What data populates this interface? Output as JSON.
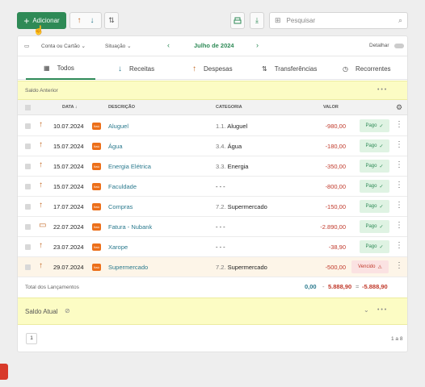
{
  "toolbar": {
    "add_label": "Adicionar",
    "search_placeholder": "Pesquisar"
  },
  "filters": {
    "account": "Conta ou Cartão",
    "status": "Situação",
    "month": "Julho de 2024",
    "detail": "Detalhar"
  },
  "tabs": [
    {
      "label": "Todos",
      "icon": "calendar-icon"
    },
    {
      "label": "Receitas",
      "icon": "arrow-down-icon"
    },
    {
      "label": "Despesas",
      "icon": "arrow-up-icon"
    },
    {
      "label": "Transferências",
      "icon": "transfer-icon"
    },
    {
      "label": "Recorrentes",
      "icon": "clock-icon"
    }
  ],
  "saldo_anterior": {
    "label": "Saldo Anterior",
    "more": "• • •"
  },
  "columns": {
    "data": "DATA ↓",
    "descricao": "DESCRIÇÃO",
    "categoria": "CATEGORIA",
    "valor": "VALOR"
  },
  "rows": [
    {
      "date": "10.07.2024",
      "desc": "Aluguel",
      "cat_num": "1.1.",
      "cat": "Aluguel",
      "value": "-980,00",
      "status": "Pago",
      "icon": "arrow-up-icon"
    },
    {
      "date": "15.07.2024",
      "desc": "Água",
      "cat_num": "3.4.",
      "cat": "Água",
      "value": "-180,00",
      "status": "Pago",
      "icon": "arrow-up-icon"
    },
    {
      "date": "15.07.2024",
      "desc": "Energia Elétrica",
      "cat_num": "3.3.",
      "cat": "Energia",
      "value": "-350,00",
      "status": "Pago",
      "icon": "arrow-up-icon"
    },
    {
      "date": "15.07.2024",
      "desc": "Faculdade",
      "cat_num": "",
      "cat": "- - -",
      "value": "-800,00",
      "status": "Pago",
      "icon": "arrow-up-icon"
    },
    {
      "date": "17.07.2024",
      "desc": "Compras",
      "cat_num": "7.2.",
      "cat": "Supermercado",
      "value": "-150,00",
      "status": "Pago",
      "icon": "arrow-up-icon"
    },
    {
      "date": "22.07.2024",
      "desc": "Fatura - Nubank",
      "cat_num": "",
      "cat": "- - -",
      "value": "-2.890,00",
      "status": "Pago",
      "icon": "card-icon"
    },
    {
      "date": "23.07.2024",
      "desc": "Xarope",
      "cat_num": "",
      "cat": "- - -",
      "value": "-38,90",
      "status": "Pago",
      "icon": "arrow-up-icon"
    },
    {
      "date": "29.07.2024",
      "desc": "Supermercado",
      "cat_num": "7.2.",
      "cat": "Supermercado",
      "value": "-500,00",
      "status": "Vencido",
      "icon": "arrow-up-icon"
    }
  ],
  "bank_label": "Itaú",
  "totals": {
    "label": "Total dos Lançamentos",
    "income": "0,00",
    "sep1": "-",
    "expense": "5.888,90",
    "sep2": "=",
    "result": "-5.888,90"
  },
  "saldo_atual": {
    "label": "Saldo Atual",
    "more": "• • •"
  },
  "pagination": {
    "page": "1",
    "range": "1 a 8"
  },
  "colors": {
    "accent": "#2e8a56",
    "negative": "#c0392b",
    "brand_orange": "#ec6f1a",
    "band": "#fcfcc4"
  }
}
